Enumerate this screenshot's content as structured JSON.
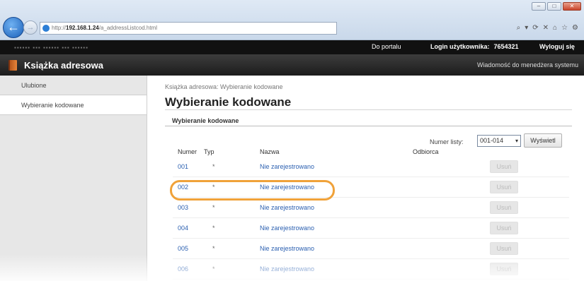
{
  "browser": {
    "url_prefix": "http://",
    "url_host": "192.168.1.24",
    "url_path": "/a_addressListcod.html",
    "window_buttons": [
      "–",
      "□",
      "✕"
    ],
    "toolbar_icons": [
      "search-icon",
      "refresh-icon",
      "close-icon",
      "home-icon",
      "favorites-icon",
      "settings-icon"
    ],
    "toolbar_glyphs": [
      "⌕",
      "▾",
      "⟳",
      "✕",
      "⌂",
      "☆",
      "⚙"
    ]
  },
  "topbar": {
    "portal_link": "Do portalu",
    "login_label": "Login użytkownika:",
    "login_value": "7654321",
    "logout_link": "Wyloguj się"
  },
  "titlebar": {
    "title": "Książka adresowa",
    "message_link": "Wiadomość do menedżera systemu"
  },
  "sidebar": {
    "items": [
      {
        "label": "Ulubione",
        "active": false
      },
      {
        "label": "Wybieranie kodowane",
        "active": true
      }
    ]
  },
  "main": {
    "breadcrumb": "Książka adresowa: Wybieranie kodowane",
    "page_title": "Wybieranie kodowane",
    "section_title": "Wybieranie kodowane",
    "list_no_label": "Numer listy:",
    "list_no_value": "001-014",
    "show_button": "Wyświetl",
    "columns": [
      "Numer",
      "Typ",
      "Nazwa",
      "Odbiorca"
    ],
    "rows": [
      {
        "num": "001",
        "typ": "*",
        "name": "Nie zarejestrowano",
        "delete": "Usuń"
      },
      {
        "num": "002",
        "typ": "*",
        "name": "Nie zarejestrowano",
        "delete": "Usuń"
      },
      {
        "num": "003",
        "typ": "*",
        "name": "Nie zarejestrowano",
        "delete": "Usuń"
      },
      {
        "num": "004",
        "typ": "*",
        "name": "Nie zarejestrowano",
        "delete": "Usuń"
      },
      {
        "num": "005",
        "typ": "*",
        "name": "Nie zarejestrowano",
        "delete": "Usuń"
      },
      {
        "num": "006",
        "typ": "*",
        "name": "Nie zarejestrowano",
        "delete": "Usuń"
      }
    ],
    "highlighted_row": "002",
    "highlight_color": "#f0a23a"
  }
}
